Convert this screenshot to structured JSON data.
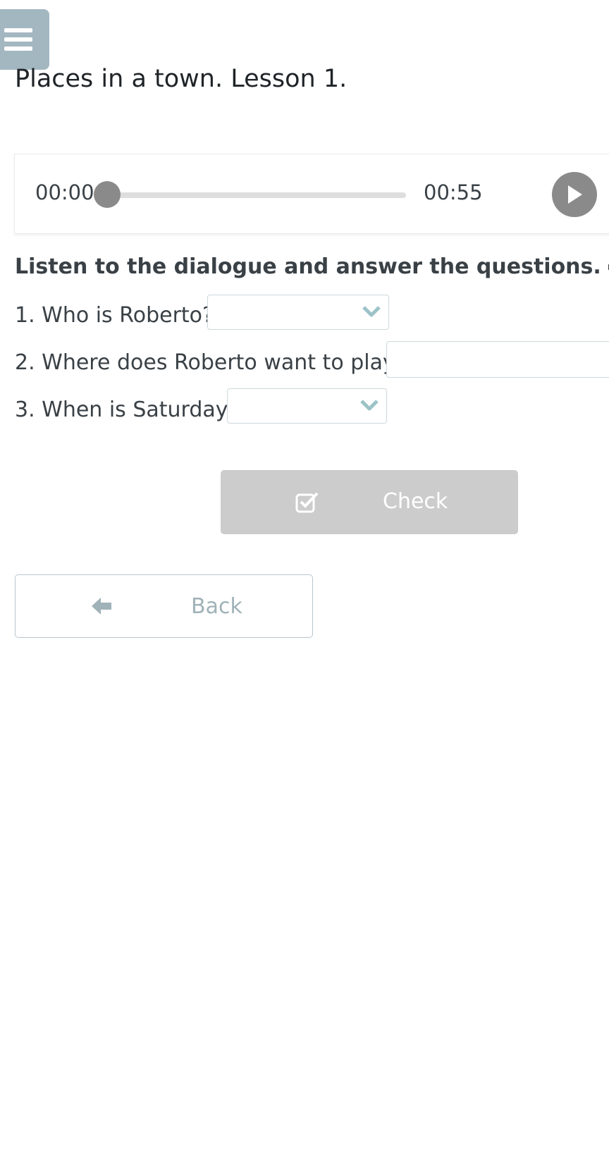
{
  "menu": {
    "icon": "hamburger-icon"
  },
  "page": {
    "title": "Places in a town. Lesson 1."
  },
  "audio_player": {
    "current_time": "00:00",
    "total_time": "00:55",
    "progress_fraction": 0,
    "play_icon": "play-icon"
  },
  "exercise": {
    "instruction": "Listen to the dialogue and answer the questions.",
    "instruction_icon": "speaker-icon",
    "questions": [
      {
        "text": "1. Who is Roberto?",
        "answer_type": "select",
        "value": ""
      },
      {
        "text": "2. Where does Roberto want to play?",
        "answer_type": "text",
        "value": ""
      },
      {
        "text": "3. When is Saturday?",
        "answer_type": "select",
        "value": ""
      }
    ]
  },
  "actions": {
    "check_label": "Check",
    "check_icon": "checkbox-check-icon",
    "back_label": "Back",
    "back_icon": "arrow-left-icon"
  },
  "colors": {
    "menu_bg": "#a3b7c1",
    "chevron": "#9cc3c7",
    "check_button_bg": "#cccccc",
    "player_grey": "#8a8a8a",
    "back_text": "#9fb2b8"
  }
}
